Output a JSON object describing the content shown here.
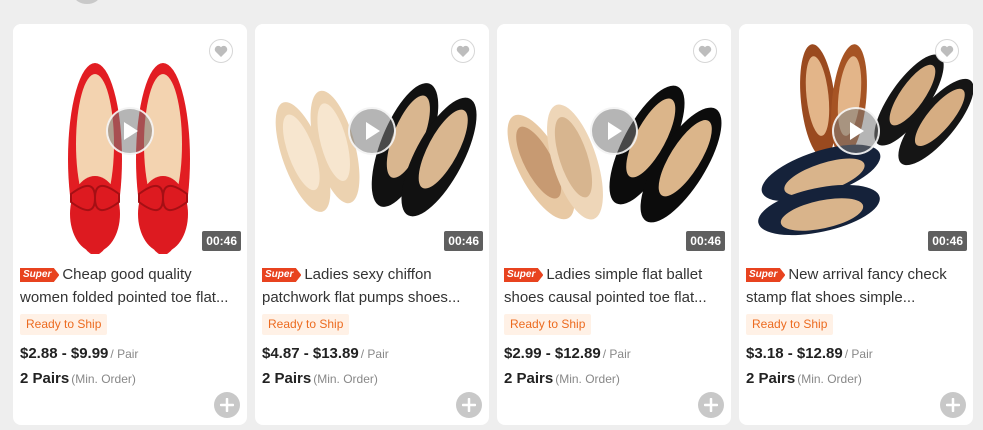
{
  "colors": {
    "super": "#e8431f",
    "ready_bg": "#fff1e6",
    "ready_text": "#ec6b20"
  },
  "icons": {
    "favorite": "heart-icon",
    "play": "play-icon",
    "add": "plus-icon"
  },
  "products": [
    {
      "super": "Super",
      "title": "Cheap good quality women folded pointed toe flat...",
      "duration": "00:46",
      "badge": "Ready to Ship",
      "price": "$2.88 - $9.99",
      "price_unit": "/ Pair",
      "moq": "2 Pairs",
      "moq_label": "(Min. Order)",
      "shoe_color": "red"
    },
    {
      "super": "Super",
      "title": "Ladies sexy chiffon patchwork flat pumps shoes...",
      "duration": "00:46",
      "badge": "Ready to Ship",
      "price": "$4.87 - $13.89",
      "price_unit": "/ Pair",
      "moq": "2 Pairs",
      "moq_label": "(Min. Order)",
      "shoe_color": "beige and black"
    },
    {
      "super": "Super",
      "title": "Ladies simple flat ballet shoes causal pointed toe flat...",
      "duration": "00:46",
      "badge": "Ready to Ship",
      "price": "$2.99 - $12.89",
      "price_unit": "/ Pair",
      "moq": "2 Pairs",
      "moq_label": "(Min. Order)",
      "shoe_color": "beige and black"
    },
    {
      "super": "Super",
      "title": "New arrival fancy check stamp flat shoes simple...",
      "duration": "00:46",
      "badge": "Ready to Ship",
      "price": "$3.18 - $12.89",
      "price_unit": "/ Pair",
      "moq": "2 Pairs",
      "moq_label": "(Min. Order)",
      "shoe_color": "brown, black and navy"
    }
  ]
}
